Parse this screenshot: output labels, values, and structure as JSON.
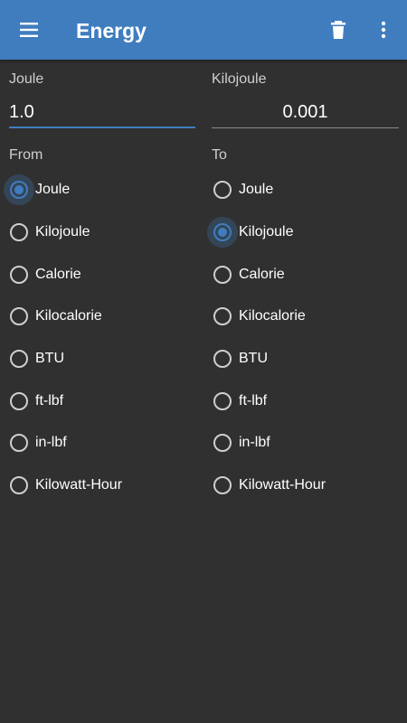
{
  "appbar": {
    "title": "Energy",
    "menu_icon": "menu-icon",
    "delete_icon": "delete-icon",
    "more_icon": "more-vert-icon",
    "color": "#3f7dbf"
  },
  "from": {
    "unit_label": "Joule",
    "value": "1.0",
    "section_label": "From",
    "selected": "Joule",
    "options": [
      "Joule",
      "Kilojoule",
      "Calorie",
      "Kilocalorie",
      "BTU",
      "ft-lbf",
      "in-lbf",
      "Kilowatt-Hour"
    ]
  },
  "to": {
    "unit_label": "Kilojoule",
    "value": "0.001",
    "section_label": "To",
    "selected": "Kilojoule",
    "options": [
      "Joule",
      "Kilojoule",
      "Calorie",
      "Kilocalorie",
      "BTU",
      "ft-lbf",
      "in-lbf",
      "Kilowatt-Hour"
    ]
  }
}
